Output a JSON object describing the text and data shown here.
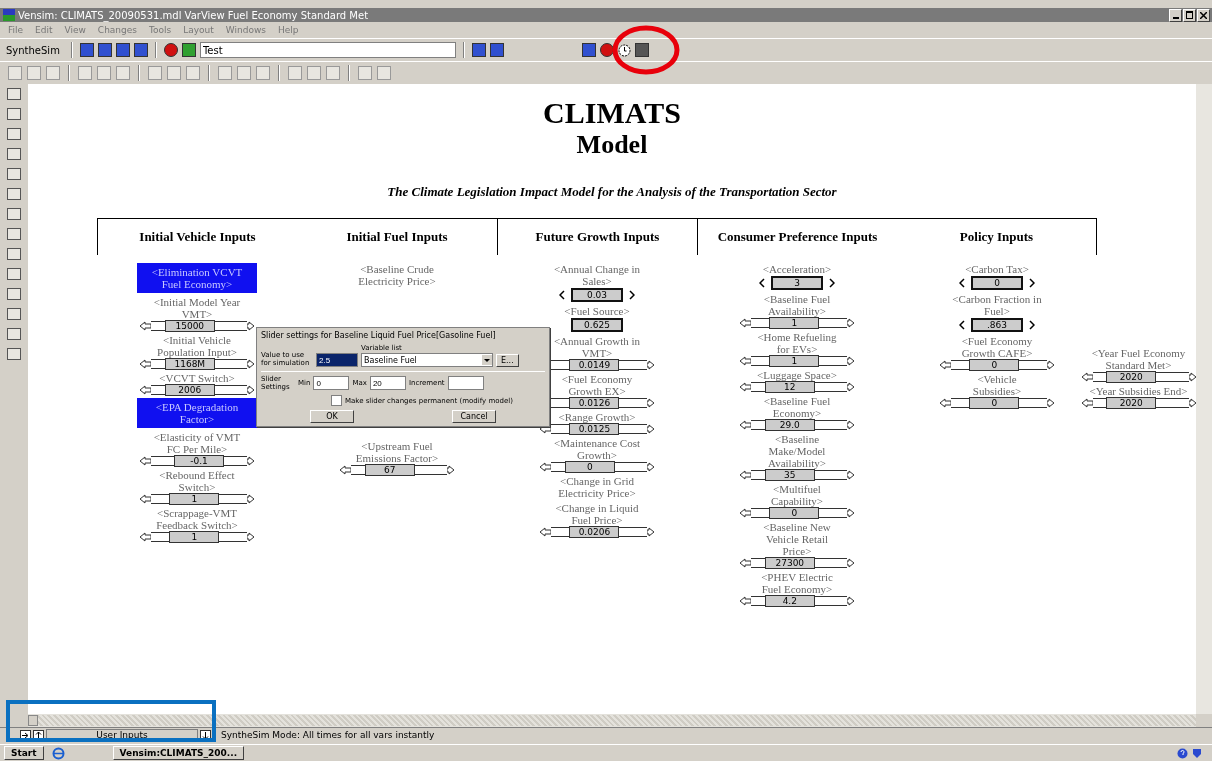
{
  "window": {
    "title": "Vensim: CLIMATS_20090531.mdl VarView Fuel Economy Standard Met"
  },
  "menu": [
    "File",
    "Edit",
    "View",
    "Changes",
    "Tools",
    "Layout",
    "Windows",
    "Help"
  ],
  "toolbar": {
    "mode": "SyntheSim",
    "text_field": "Test"
  },
  "canvas": {
    "title": "CLIMATS",
    "title_line_2": "Model",
    "subtitle": "The Climate Legislation Impact Model for the Analysis of the Transportation Sector",
    "columns": [
      {
        "heading": "Initial Vehicle Inputs",
        "items": [
          {
            "label": "<Elimination VCVT Fuel Economy>",
            "kind": "none",
            "highlighted": true
          },
          {
            "label": "<Initial Model Year VMT>",
            "kind": "slider",
            "value": "15000",
            "level": 0.3,
            "highlighted": false
          },
          {
            "label": "<Initial Vehicle Population Input>",
            "kind": "slider",
            "value": "1168M",
            "level": 0.3,
            "highlighted": false
          },
          {
            "label": "<VCVT Switch>",
            "kind": "slider",
            "value": "2006",
            "level": 0.3,
            "highlighted": false
          },
          {
            "label": "<EPA Degradation Factor>",
            "kind": "none",
            "highlighted": true
          },
          {
            "label": "<Elasticity of VMT FC Per Mile>",
            "kind": "slider",
            "value": "-0.1",
            "level": 0.5,
            "highlighted": false
          },
          {
            "label": "<Rebound Effect Switch>",
            "kind": "slider",
            "value": "1",
            "level": 0.4,
            "highlighted": false
          },
          {
            "label": "<Scrappage-VMT Feedback Switch>",
            "kind": "slider",
            "value": "1",
            "level": 0.4,
            "highlighted": false
          }
        ]
      },
      {
        "heading": "Initial Fuel Inputs",
        "items": [
          {
            "label": "<Baseline Crude Electricity Price>",
            "kind": "none",
            "highlighted": false
          },
          {
            "label": "<Upstream Fuel Emissions Factor>",
            "kind": "slider",
            "value": "67",
            "level": 0.3,
            "highlighted": false
          }
        ]
      },
      {
        "heading": "Future Growth Inputs",
        "items": [
          {
            "label": "<Annual Change in Sales>",
            "kind": "stepper",
            "value": "0.03",
            "highlighted": false
          },
          {
            "label": "<Fuel Source>",
            "kind": "box",
            "value": "0.625",
            "highlighted": false
          },
          {
            "label": "<Annual Growth in VMT>",
            "kind": "slider",
            "value": "0.0149",
            "level": 0.4,
            "highlighted": false
          },
          {
            "label": "<Fuel Economy Growth EX>",
            "kind": "slider",
            "value": "0.0126",
            "level": 0.4,
            "highlighted": false
          },
          {
            "label": "<Range Growth>",
            "kind": "slider",
            "value": "0.0125",
            "level": 0.4,
            "highlighted": false
          },
          {
            "label": "<Maintenance Cost Growth>",
            "kind": "slider",
            "value": "0",
            "level": 0.3,
            "highlighted": false
          },
          {
            "label": "<Change in Grid Electricity Price>",
            "kind": "none",
            "highlighted": false
          },
          {
            "label": "<Change in Liquid Fuel Price>",
            "kind": "slider",
            "value": "0.0206",
            "level": 0.4,
            "highlighted": false
          }
        ]
      },
      {
        "heading": "Consumer Preference Inputs",
        "items": [
          {
            "label": "<Acceleration>",
            "kind": "stepper",
            "value": "3",
            "highlighted": false
          },
          {
            "label": "<Baseline Fuel Availability>",
            "kind": "slider",
            "value": "1",
            "level": 0.4,
            "highlighted": false
          },
          {
            "label": "<Home Refueling for EVs>",
            "kind": "slider",
            "value": "1",
            "level": 0.4,
            "highlighted": false
          },
          {
            "label": "<Luggage Space>",
            "kind": "slider",
            "value": "12",
            "level": 0.3,
            "highlighted": false
          },
          {
            "label": "<Baseline Fuel Economy>",
            "kind": "slider",
            "value": "29.0",
            "level": 0.3,
            "highlighted": false
          },
          {
            "label": "<Baseline Make/Model Availability>",
            "kind": "slider",
            "value": "35",
            "level": 0.3,
            "highlighted": false
          },
          {
            "label": "<Multifuel Capability>",
            "kind": "slider",
            "value": "0",
            "level": 0.4,
            "highlighted": false
          },
          {
            "label": "<Baseline New Vehicle Retail Price>",
            "kind": "slider",
            "value": "27300",
            "level": 0.3,
            "highlighted": false
          },
          {
            "label": "<PHEV Electric Fuel Economy>",
            "kind": "slider",
            "value": "4.2",
            "level": 0.3,
            "highlighted": false
          }
        ]
      },
      {
        "heading": "Policy Inputs",
        "items": [
          {
            "label": "<Carbon Tax>",
            "kind": "stepper",
            "value": "0",
            "highlighted": false
          },
          {
            "label": "<Carbon Fraction in Fuel>",
            "kind": "stepper",
            "value": ".863",
            "highlighted": false
          },
          {
            "label": "<Fuel Economy Growth CAFE>",
            "kind": "slider",
            "value": "0",
            "level": 0.4,
            "highlighted": false
          },
          {
            "label": "<Vehicle Subsidies>",
            "kind": "slider",
            "value": "0",
            "level": 0.4,
            "highlighted": false
          }
        ],
        "side_items": [
          {
            "label": "<Year Fuel Economy Standard Met>",
            "kind": "slider",
            "value": "2020",
            "level": 0.3,
            "highlighted": false
          },
          {
            "label": "<Year Subsidies End>",
            "kind": "slider",
            "value": "2020",
            "level": 0.3,
            "highlighted": false
          }
        ]
      }
    ]
  },
  "dialog": {
    "title": "Slider settings for Baseline Liquid Fuel Price[Gasoline Fuel]",
    "value_label": "Value to use for simulation",
    "value": "2.5",
    "variable_label": "Variable list",
    "variable": "Baseline Fuel",
    "edit_button": "E...",
    "settings_label": "Slider Settings",
    "min_label": "Min",
    "min": "0",
    "max_label": "Max",
    "max": "20",
    "increment_label": "Increment",
    "permanent_label": "Make slider changes permanent (modify model)",
    "permanent_checked": false,
    "ok": "OK",
    "cancel": "Cancel"
  },
  "tab_bar": {
    "tab": "User Inputs",
    "status": "SyntheSim Mode: All times for all vars instantly"
  },
  "taskbar": {
    "start": "Start",
    "task": "Vensim:CLIMATS_200..."
  }
}
